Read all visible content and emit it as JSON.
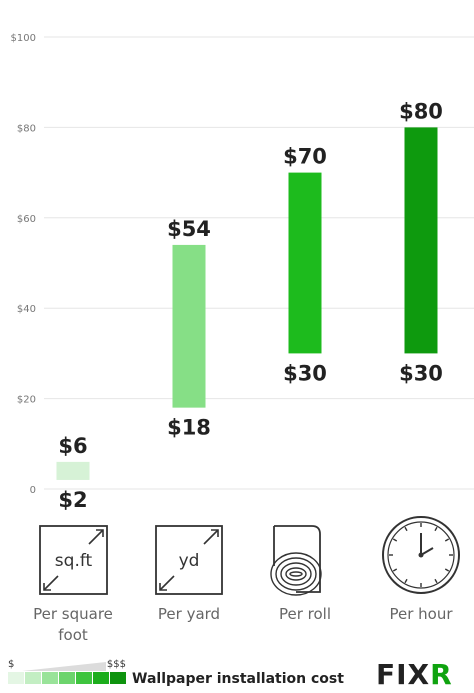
{
  "chart_data": {
    "type": "bar",
    "title": "",
    "xlabel": "",
    "ylabel": "",
    "ylim": [
      0,
      100
    ],
    "yticks": [
      0,
      20,
      40,
      60,
      80,
      100
    ],
    "ytick_labels": [
      "0",
      "$20",
      "$40",
      "$60",
      "$80",
      "$100"
    ],
    "grid": true,
    "categories": [
      "Per square foot",
      "Per yard",
      "Per roll",
      "Per hour"
    ],
    "category_label_lines": [
      [
        "Per square",
        "foot"
      ],
      [
        "Per yard"
      ],
      [
        "Per roll"
      ],
      [
        "Per hour"
      ]
    ],
    "series": [
      {
        "low": [
          2,
          18,
          30,
          30
        ],
        "high": [
          6,
          54,
          70,
          80
        ],
        "low_labels": [
          "$2",
          "$18",
          "$30",
          "$30"
        ],
        "high_labels": [
          "$6",
          "$54",
          "$70",
          "$80"
        ],
        "colors": [
          "#d6f2d6",
          "#86df86",
          "#1dbb1d",
          "#0e9a0e"
        ]
      }
    ]
  },
  "icons": [
    {
      "name": "square-foot-icon",
      "text": "sq.ft"
    },
    {
      "name": "yard-icon",
      "text": "yd"
    },
    {
      "name": "roll-icon"
    },
    {
      "name": "clock-icon"
    }
  ],
  "legend": {
    "low": "$",
    "high": "$$$",
    "caption": "Wallpaper installation cost",
    "swatches": [
      "#e4f6e4",
      "#c3eec3",
      "#99e399",
      "#6cd46c",
      "#3ec43e",
      "#1cad1c",
      "#0e930e"
    ]
  },
  "brand": {
    "name": "FIXR",
    "color": "#0fa30f"
  }
}
